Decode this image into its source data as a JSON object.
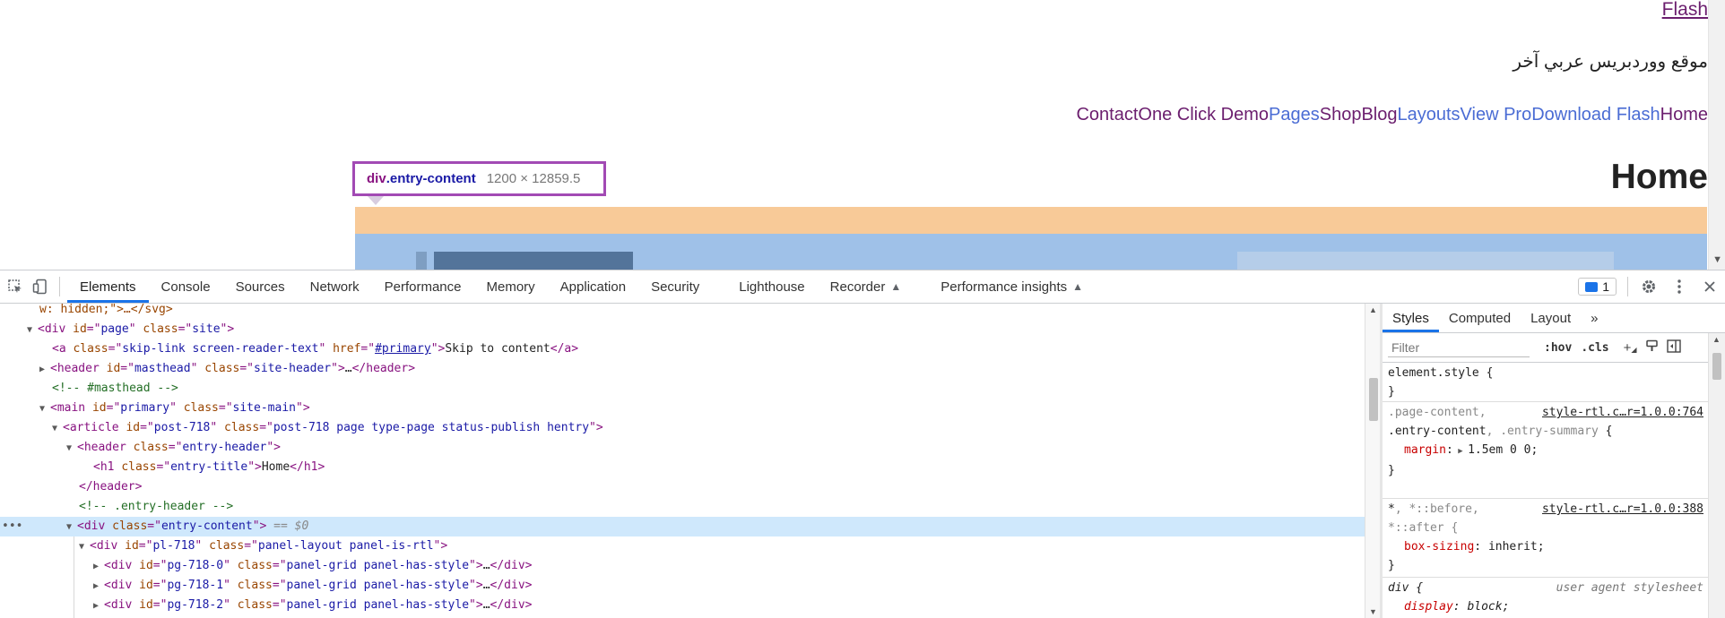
{
  "page": {
    "top_link": "Flash",
    "site_description": "موقع ووردبريس عربي آخر",
    "menu": [
      "Contact",
      "One Click Demo",
      "Pages",
      "Shop",
      "Blog",
      "Layouts",
      "View Pro",
      "Download Flash",
      "Home"
    ],
    "menu_colors": [
      "#6b1e6e",
      "#6b1e6e",
      "#4a6cd4",
      "#6b1e6e",
      "#6b1e6e",
      "#4a6cd4",
      "#4a6cd4",
      "#4a6cd4",
      "#6b1e6e"
    ],
    "entry_title": "Home",
    "tooltip": {
      "tag": "div",
      "class": ".entry-content",
      "dims": "1200 × 12859.5"
    }
  },
  "devtools": {
    "tabs": [
      "Elements",
      "Console",
      "Sources",
      "Network",
      "Performance",
      "Memory",
      "Application",
      "Security",
      "Lighthouse",
      "Recorder",
      "Performance insights"
    ],
    "active_tab": "Elements",
    "issues_count": "1",
    "elements": {
      "l0": {
        "text": "w: hidden;\">…</svg>"
      },
      "l1": {
        "tag": "div",
        "attrs": [
          [
            "id",
            "page"
          ],
          [
            "class",
            "site"
          ]
        ]
      },
      "l2": {
        "pre": "<a ",
        "a1n": "class",
        "a1v": "skip-link screen-reader-text",
        "a2n": "href",
        "a2v": "#primary",
        "text": "Skip to content",
        "close": "</a>"
      },
      "l3": {
        "tag": "header",
        "attrs": [
          [
            "id",
            "masthead"
          ],
          [
            "class",
            "site-header"
          ]
        ],
        "ellipsis": "…</header>"
      },
      "l4": {
        "comment": "<!-- #masthead -->"
      },
      "l5": {
        "tag": "main",
        "attrs": [
          [
            "id",
            "primary"
          ],
          [
            "class",
            "site-main"
          ]
        ]
      },
      "l6": {
        "tag": "article",
        "attrs": [
          [
            "id",
            "post-718"
          ],
          [
            "class",
            "post-718 page type-page status-publish hentry"
          ]
        ]
      },
      "l7": {
        "tag": "header",
        "attrs": [
          [
            "class",
            "entry-header"
          ]
        ]
      },
      "l8": {
        "tag": "h1",
        "attrs": [
          [
            "class",
            "entry-title"
          ]
        ],
        "text": "Home",
        "close": "</h1>"
      },
      "l9": {
        "close": "</header>"
      },
      "l10": {
        "comment": "<!-- .entry-header -->"
      },
      "l11": {
        "tag": "div",
        "attrs": [
          [
            "class",
            "entry-content"
          ]
        ],
        "suffix": " == $0"
      },
      "l12": {
        "tag": "div",
        "attrs": [
          [
            "id",
            "pl-718"
          ],
          [
            "class",
            "panel-layout panel-is-rtl"
          ]
        ]
      },
      "l13": {
        "tag": "div",
        "attrs": [
          [
            "id",
            "pg-718-0"
          ],
          [
            "class",
            "panel-grid panel-has-style"
          ]
        ],
        "ellipsis": "…</div>"
      },
      "l14": {
        "tag": "div",
        "attrs": [
          [
            "id",
            "pg-718-1"
          ],
          [
            "class",
            "panel-grid panel-has-style"
          ]
        ],
        "ellipsis": "…</div>"
      },
      "l15": {
        "tag": "div",
        "attrs": [
          [
            "id",
            "pg-718-2"
          ],
          [
            "class",
            "panel-grid panel-has-style"
          ]
        ],
        "ellipsis": "…</div>"
      }
    },
    "styles_tabs": [
      "Styles",
      "Computed",
      "Layout",
      "»"
    ],
    "filter_placeholder": "Filter",
    "hov": ":hov",
    "cls": ".cls",
    "rules": {
      "r0": {
        "selector": "element.style {",
        "close": "}"
      },
      "r1": {
        "sel1": ".page-content,",
        "src": "style-rtl.c…r=1.0.0:764",
        "sel2a": ".entry-content",
        "sel2b": ", ",
        "sel2c": ".entry-summary",
        "sel2d": " {",
        "prop": "margin",
        "val": "1.5em 0 0;",
        "close": "}"
      },
      "r2": {
        "sel1a": "*",
        "sel1b": ", *::before,",
        "src": "style-rtl.c…r=1.0.0:388",
        "sel2": "*::after {",
        "prop": "box-sizing",
        "val": "inherit;",
        "close": "}"
      },
      "r3": {
        "selector": "div {",
        "src": "user agent stylesheet",
        "prop": "display",
        "val": "block;",
        "close": "}"
      }
    }
  }
}
